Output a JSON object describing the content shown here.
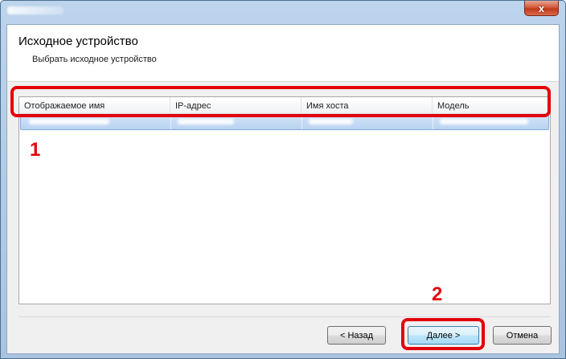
{
  "window": {
    "close_glyph": "x"
  },
  "header": {
    "title": "Исходное устройство",
    "subtitle": "Выбрать исходное устройство"
  },
  "device_list": {
    "columns": [
      "Отображаемое имя",
      "IP-адрес",
      "Имя хоста",
      "Модель"
    ],
    "selected_row_count": 1
  },
  "buttons": {
    "back": "< Назад",
    "next": "Далее >",
    "cancel": "Отмена"
  },
  "callouts": [
    "1",
    "2"
  ],
  "colors": {
    "callout": "#e3000b",
    "selection": "#b9d3f1",
    "close_button": "#c2381a"
  },
  "icons": {
    "close": "close-icon"
  }
}
